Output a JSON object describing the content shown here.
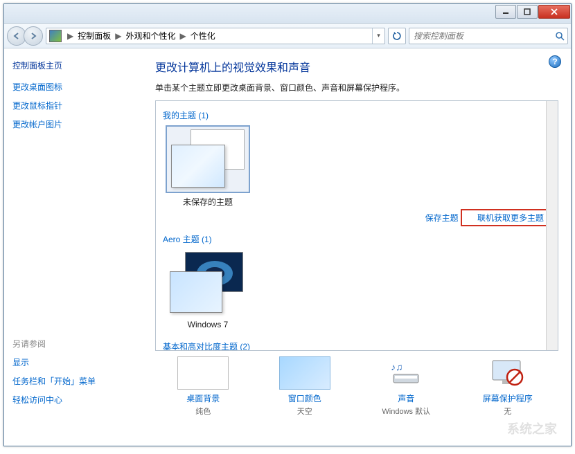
{
  "titlebar": {
    "min": "—",
    "max": "☐",
    "close": "X"
  },
  "breadcrumb": {
    "items": [
      "控制面板",
      "外观和个性化",
      "个性化"
    ]
  },
  "search": {
    "placeholder": "搜索控制面板"
  },
  "sidebar": {
    "home": "控制面板主页",
    "links": [
      "更改桌面图标",
      "更改鼠标指针",
      "更改帐户图片"
    ],
    "see_also_title": "另请参阅",
    "see_also": [
      "显示",
      "任务栏和「开始」菜单",
      "轻松访问中心"
    ]
  },
  "content": {
    "title": "更改计算机上的视觉效果和声音",
    "desc": "单击某个主题立即更改桌面背景、窗口颜色、声音和屏幕保护程序。",
    "my_themes_header": "我的主题 (1)",
    "unsaved_theme": "未保存的主题",
    "save_theme": "保存主题",
    "get_more": "联机获取更多主题",
    "aero_header": "Aero 主题 (1)",
    "aero_theme": "Windows 7",
    "basic_header": "基本和高对比度主题 (2)"
  },
  "bottom": {
    "bg_label": "桌面背景",
    "bg_sub": "纯色",
    "color_label": "窗口颜色",
    "color_sub": "天空",
    "sound_label": "声音",
    "sound_sub": "Windows 默认",
    "saver_label": "屏幕保护程序",
    "saver_sub": "无"
  },
  "watermark": "系统之家"
}
